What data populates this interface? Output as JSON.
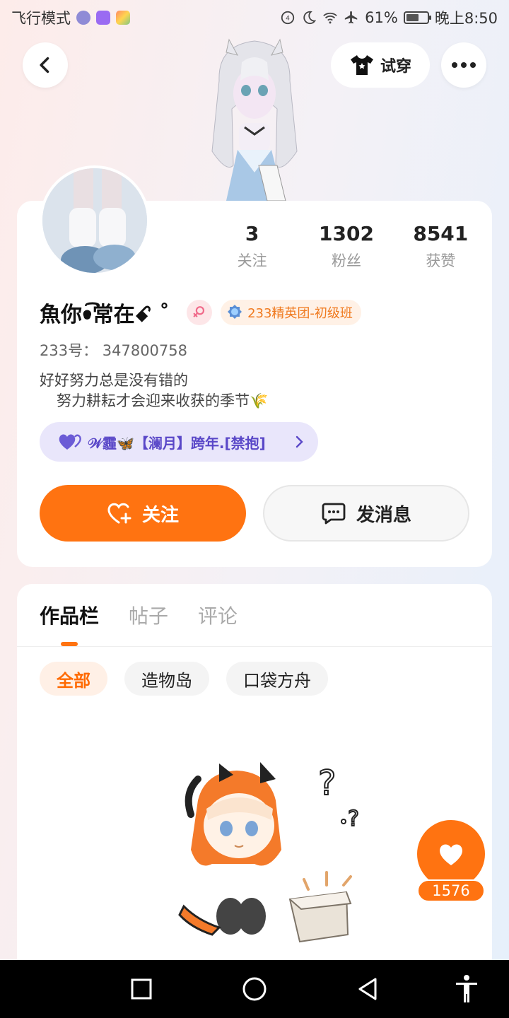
{
  "status_bar": {
    "left_text": "飞行模式",
    "battery": "61%",
    "time": "晚上8:50",
    "battery_level": 0.61
  },
  "header": {
    "tryon_label": "试穿"
  },
  "profile": {
    "stats": [
      {
        "num": "3",
        "label": "关注"
      },
      {
        "num": "1302",
        "label": "粉丝"
      },
      {
        "num": "8541",
        "label": "获赞"
      }
    ],
    "nickname": "魚你ꔷ⃘͡常在ꗃ ˚",
    "level_badge": "233精英团-初级班",
    "uid": "233号：  347800758",
    "bio": [
      "好好努力总是没有错的",
      "努力耕耘才会迎来收获的季节🌾"
    ],
    "relation": "𝒲霾🦋【澜月】跨年.[禁抱]",
    "follow_label": "关注",
    "message_label": "发消息"
  },
  "works": {
    "tabs": [
      "作品栏",
      "帖子",
      "评论"
    ],
    "chips": [
      "全部",
      "造物岛",
      "口袋方舟"
    ]
  },
  "likes": {
    "count": "1576"
  },
  "colors": {
    "accent": "#ff7311",
    "relation_bg": "#e9e6fb",
    "relation_text": "#5a48c8"
  }
}
